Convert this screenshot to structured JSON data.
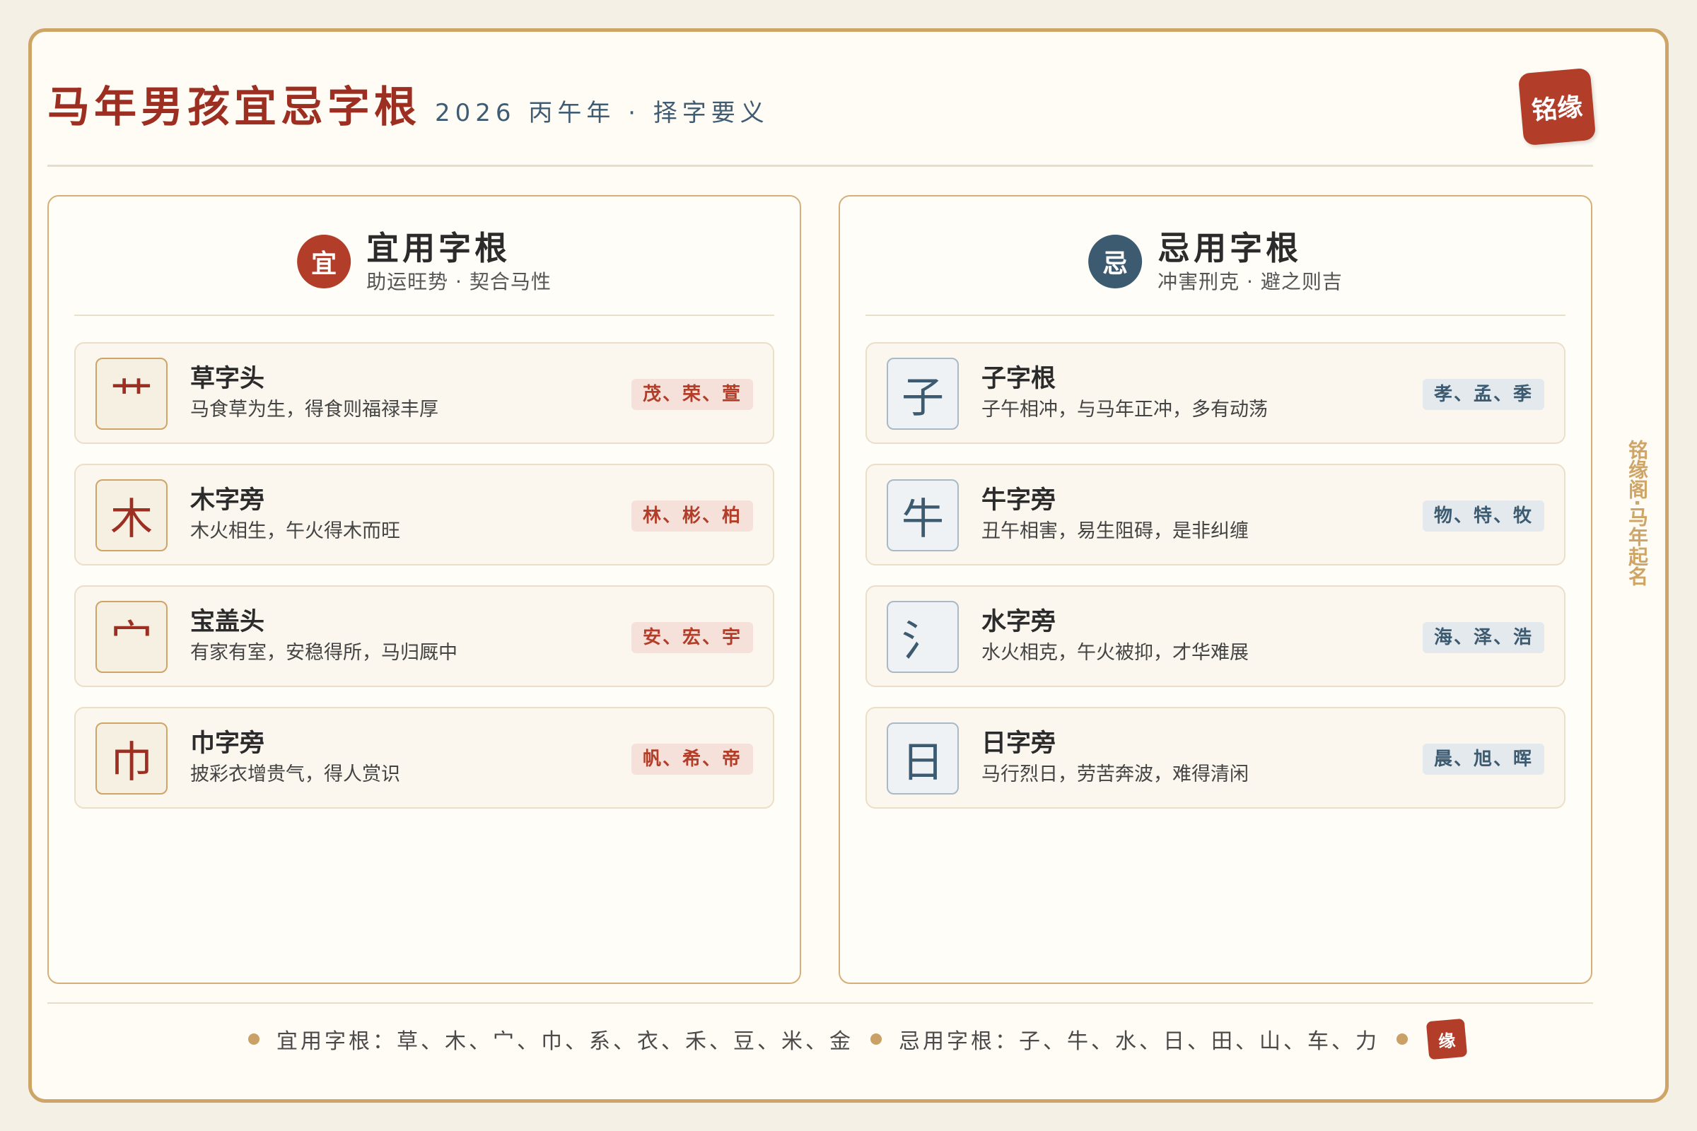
{
  "header": {
    "title": "马年男孩宜忌字根",
    "subtitle": "2026 丙午年 · 择字要义",
    "seal": "铭缘"
  },
  "left_panel": {
    "badge": "宜",
    "title": "宜用字根",
    "subtitle": "助运旺势 · 契合马性",
    "items": [
      {
        "glyph": "艹",
        "name": "草字头",
        "desc": "马食草为生，得食则福禄丰厚",
        "examples": "茂、荣、萱"
      },
      {
        "glyph": "木",
        "name": "木字旁",
        "desc": "木火相生，午火得木而旺",
        "examples": "林、彬、柏"
      },
      {
        "glyph": "宀",
        "name": "宝盖头",
        "desc": "有家有室，安稳得所，马归厩中",
        "examples": "安、宏、宇"
      },
      {
        "glyph": "巾",
        "name": "巾字旁",
        "desc": "披彩衣增贵气，得人赏识",
        "examples": "帆、希、帝"
      }
    ]
  },
  "right_panel": {
    "badge": "忌",
    "title": "忌用字根",
    "subtitle": "冲害刑克 · 避之则吉",
    "items": [
      {
        "glyph": "子",
        "name": "子字根",
        "desc": "子午相冲，与马年正冲，多有动荡",
        "examples": "孝、孟、季"
      },
      {
        "glyph": "牛",
        "name": "牛字旁",
        "desc": "丑午相害，易生阻碍，是非纠缠",
        "examples": "物、特、牧"
      },
      {
        "glyph": "氵",
        "name": "水字旁",
        "desc": "水火相克，午火被抑，才华难展",
        "examples": "海、泽、浩"
      },
      {
        "glyph": "日",
        "name": "日字旁",
        "desc": "马行烈日，劳苦奔波，难得清闲",
        "examples": "晨、旭、晖"
      }
    ]
  },
  "side_text": "铭缘阁·马年起名",
  "footer": {
    "yi_text": "宜用字根：草、木、宀、巾、系、衣、禾、豆、米、金",
    "ji_text": "忌用字根：子、牛、水、日、田、山、车、力",
    "seal": "缘"
  },
  "colors": {
    "accent_red": "#b23d29",
    "accent_blue": "#3c5a70",
    "border_gold": "#cfa467",
    "background": "#fefcf4"
  }
}
